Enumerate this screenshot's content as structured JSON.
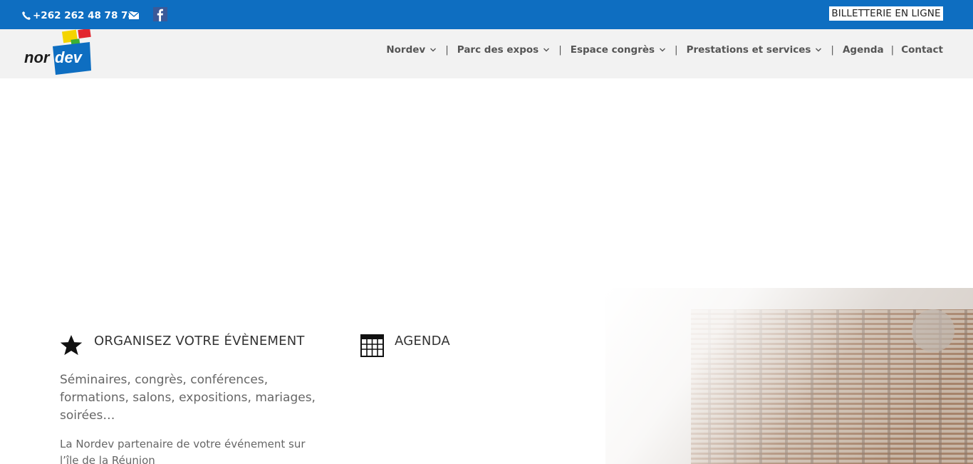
{
  "topbar": {
    "phone": "+262 262 48 78 78",
    "ticket_button": "BILLETTERIE EN LIGNE",
    "bg_color": "#0e6ec1"
  },
  "header": {
    "logo_text": "nordev",
    "nav": [
      {
        "label": "Nordev",
        "has_dropdown": true
      },
      {
        "label": "Parc des expos",
        "has_dropdown": true
      },
      {
        "label": "Espace congrès",
        "has_dropdown": true
      },
      {
        "label": "Prestations et services",
        "has_dropdown": true
      },
      {
        "label": "Agenda",
        "has_dropdown": false
      },
      {
        "label": "Contact",
        "has_dropdown": false
      }
    ],
    "separator": "|"
  },
  "features": {
    "organise": {
      "title": "ORGANISEZ VOTRE ÉVÈNEMENT",
      "lead": "Séminaires, congrès, conférences, formations, salons, expositions, mariages, soirées…",
      "body": "La Nordev partenaire de votre événement sur l’île de la Réunion"
    },
    "agenda": {
      "title": "AGENDA"
    }
  },
  "icons": {
    "phone": "phone-icon",
    "mail": "mail-icon",
    "facebook": "facebook-icon",
    "star": "star-icon",
    "calendar": "calendar-grid-icon"
  }
}
